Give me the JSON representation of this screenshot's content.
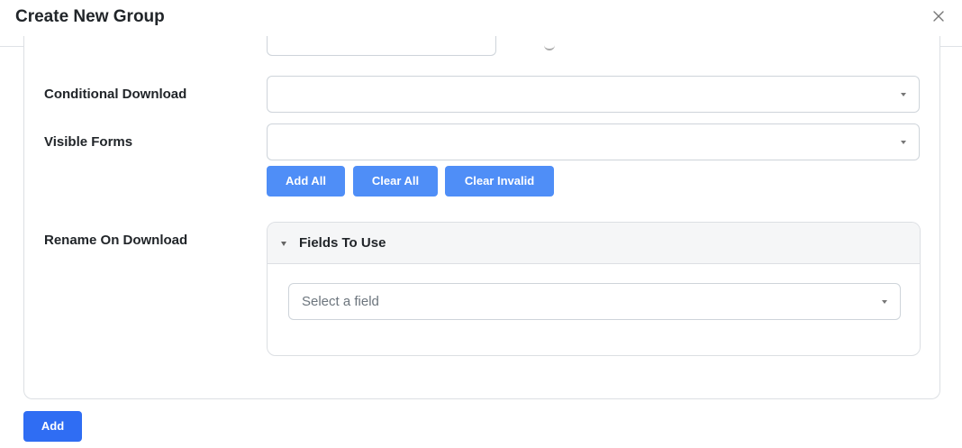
{
  "modal": {
    "title": "Create New Group",
    "close_icon": "close-icon"
  },
  "form": {
    "conditional_download": {
      "label": "Conditional Download",
      "value": ""
    },
    "visible_forms": {
      "label": "Visible Forms",
      "value": "",
      "buttons": {
        "add_all": "Add All",
        "clear_all": "Clear All",
        "clear_invalid": "Clear Invalid"
      }
    },
    "rename_on_download": {
      "label": "Rename On Download",
      "fields_panel": {
        "title": "Fields To Use",
        "expanded": true,
        "select_placeholder": "Select a field"
      }
    }
  },
  "footer": {
    "add_label": "Add"
  },
  "colors": {
    "primary_button": "#4f8ef7",
    "submit_button": "#2f6df3",
    "border": "#dcdfe3"
  }
}
